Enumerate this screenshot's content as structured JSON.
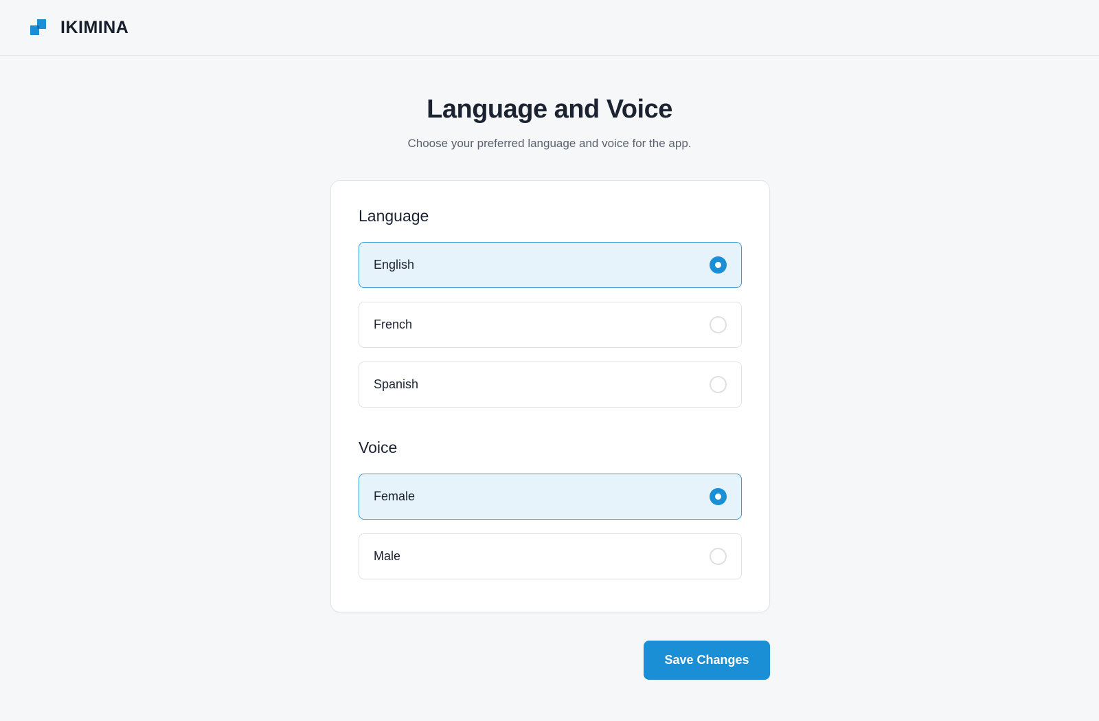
{
  "app": {
    "brand": "IKIMINA",
    "accent_color": "#1a8fd6",
    "logo_icon": "stacked-squares-logo-icon"
  },
  "page": {
    "title": "Language and Voice",
    "subtitle": "Choose your preferred language and voice for the app."
  },
  "language": {
    "heading": "Language",
    "selected": "English",
    "options": [
      {
        "label": "English",
        "selected": true
      },
      {
        "label": "French",
        "selected": false
      },
      {
        "label": "Spanish",
        "selected": false
      }
    ]
  },
  "voice": {
    "heading": "Voice",
    "selected": "Female",
    "options": [
      {
        "label": "Female",
        "selected": true
      },
      {
        "label": "Male",
        "selected": false
      }
    ]
  },
  "actions": {
    "save_label": "Save Changes"
  }
}
